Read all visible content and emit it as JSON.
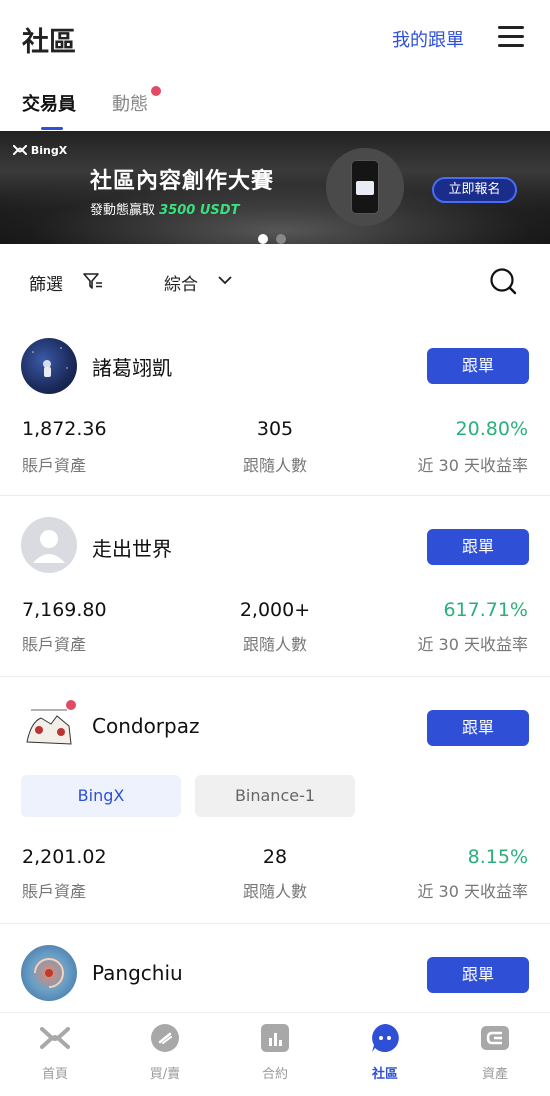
{
  "header": {
    "title": "社區",
    "my_follow": "我的跟單"
  },
  "tabs": [
    {
      "label": "交易員",
      "active": true
    },
    {
      "label": "動態",
      "active": false,
      "badge": true
    }
  ],
  "banner": {
    "logo": "BingX",
    "title": "社區內容創作大賽",
    "subtitle_prefix": "發動態贏取",
    "subtitle_amount": "3500 USDT",
    "button": "立即報名"
  },
  "filters": {
    "filter_label": "篩選",
    "sort_label": "綜合"
  },
  "traders": [
    {
      "name": "諸葛翊凱",
      "follow": "跟單",
      "assets": "1,872.36",
      "assets_label": "賬戶資產",
      "followers": "305",
      "followers_label": "跟隨人數",
      "roi": "20.80%",
      "roi_label": "近 30 天收益率"
    },
    {
      "name": "走出世界",
      "follow": "跟單",
      "assets": "7,169.80",
      "assets_label": "賬戶資產",
      "followers": "2,000+",
      "followers_label": "跟隨人數",
      "roi": "617.71%",
      "roi_label": "近 30 天收益率"
    },
    {
      "name": "Condorpaz",
      "follow": "跟單",
      "exchanges": [
        "BingX",
        "Binance-1"
      ],
      "assets": "2,201.02",
      "assets_label": "賬戶資產",
      "followers": "28",
      "followers_label": "跟隨人數",
      "roi": "8.15%",
      "roi_label": "近 30 天收益率"
    },
    {
      "name": "Pangchiu",
      "follow": "跟單"
    }
  ],
  "bottom_nav": [
    {
      "label": "首頁",
      "icon": "bingx-logo-icon"
    },
    {
      "label": "買/賣",
      "icon": "exchange-icon"
    },
    {
      "label": "合約",
      "icon": "chart-icon"
    },
    {
      "label": "社區",
      "icon": "community-icon",
      "active": true
    },
    {
      "label": "資產",
      "icon": "wallet-icon"
    }
  ],
  "colors": {
    "accent": "#2e4fd6",
    "roi_green": "#2bb07a",
    "badge_red": "#e14a62"
  }
}
